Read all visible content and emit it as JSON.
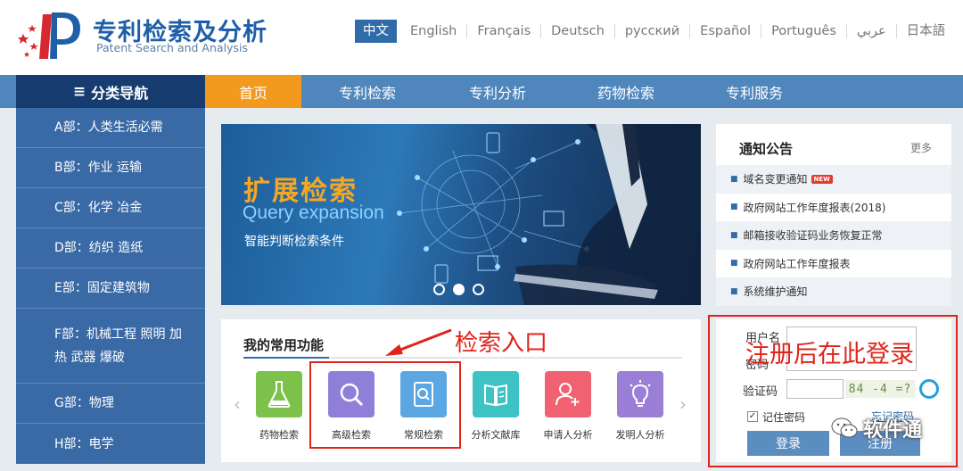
{
  "header": {
    "title": "专利检索及分析",
    "subtitle": "Patent Search and Analysis",
    "languages": [
      "中文",
      "English",
      "Français",
      "Deutsch",
      "русский",
      "Español",
      "Português",
      "عربي",
      "日本語"
    ]
  },
  "nav": {
    "category": "分类导航",
    "items": [
      "首页",
      "专利检索",
      "专利分析",
      "药物检索",
      "专利服务"
    ]
  },
  "sidebar": {
    "items": [
      "A部：人类生活必需",
      "B部：作业 运输",
      "C部：化学 冶金",
      "D部：纺织 造纸",
      "E部：固定建筑物",
      "F部：机械工程 照明 加热 武器 爆破",
      "G部：物理",
      "H部：电学"
    ]
  },
  "banner": {
    "title": "扩展检索",
    "title_en": "Query expansion",
    "subtitle": "智能判断检索条件"
  },
  "notice": {
    "title": "通知公告",
    "more": "更多",
    "new_badge": "NEW",
    "items": [
      "域名变更通知",
      "政府网站工作年度报表(2018)",
      "邮箱接收验证码业务恢复正常",
      "政府网站工作年度报表",
      "系统维护通知"
    ]
  },
  "functions": {
    "title": "我的常用功能",
    "items": [
      {
        "label": "药物检索",
        "color": "#7cc24a"
      },
      {
        "label": "高级检索",
        "color": "#8f7fd8"
      },
      {
        "label": "常规检索",
        "color": "#5ba7e3"
      },
      {
        "label": "分析文献库",
        "color": "#3ec3c4"
      },
      {
        "label": "申请人分析",
        "color": "#f06272"
      },
      {
        "label": "发明人分析",
        "color": "#9b7fd6"
      }
    ]
  },
  "annotations": {
    "search_entry": "检索入口",
    "login_hint": "注册后在此登录"
  },
  "login": {
    "username_label": "用户名",
    "password_label": "密码",
    "captcha_label": "验证码",
    "captcha_text": "84 -4 =?",
    "remember": "记住密码",
    "forgot": "忘记密码",
    "login_button": "登录",
    "register_button": "注册"
  },
  "watermark": "软件通",
  "colors": {
    "primary": "#2f6ca8",
    "nav": "#4f87bc",
    "nav_dark": "#173c70",
    "accent": "#f39a1e",
    "annotation": "#e0241b"
  }
}
